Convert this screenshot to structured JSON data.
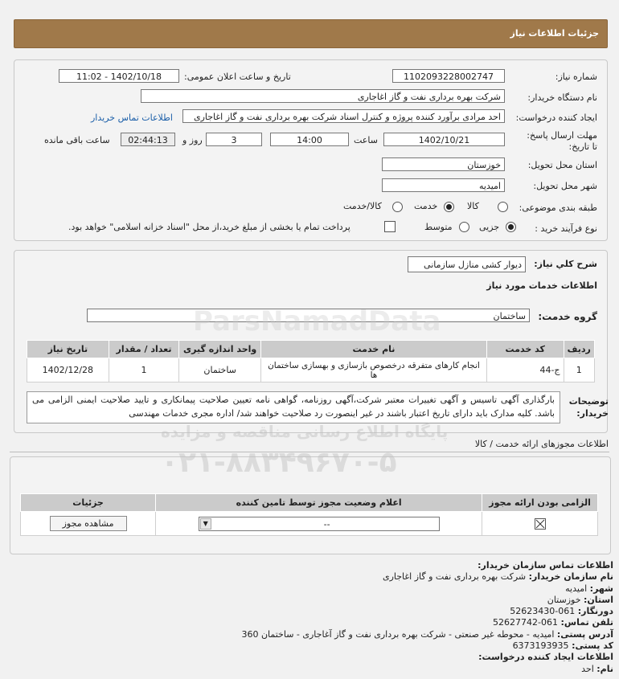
{
  "header": {
    "title": "جزئیات اطلاعات نیاز"
  },
  "need": {
    "number_label": "شماره نیاز:",
    "number": "1102093228002747",
    "announce_label": "تاریخ و ساعت اعلان عمومی:",
    "announce_value": "1402/10/18 - 11:02",
    "buyer_label": "نام دستگاه خریدار:",
    "buyer_value": "شرکت بهره برداری نفت و گاز اغاجاری",
    "creator_label": "ایجاد کننده درخواست:",
    "creator_value": "احد مرادی برآورد کننده پروژه و کنترل اسناد شرکت بهره برداری نفت و گاز اغاجاری",
    "contact_link": "اطلاعات تماس خریدار",
    "deadline_label": "مهلت ارسال پاسخ: تا تاریخ:",
    "deadline_date": "1402/10/21",
    "time_label": "ساعت",
    "deadline_time": "14:00",
    "day_suffix": "روز و",
    "days": "3",
    "remaining": "02:44:13",
    "remaining_label": "ساعت باقی مانده",
    "province_label": "استان محل تحویل:",
    "province": "خوزستان",
    "city_label": "شهر محل تحویل:",
    "city": "امیدیه",
    "category_label": "طبقه بندی موضوعی:",
    "cat_goods": "کالا",
    "cat_service": "خدمت",
    "cat_both": "کالا/خدمت",
    "process_label": "نوع فرآیند خرید :",
    "proc_partial": "جزیی",
    "proc_medium": "متوسط",
    "payment_note": "پرداخت تمام یا بخشی از مبلغ خرید،از محل \"اسناد خزانه اسلامی\" خواهد بود."
  },
  "summary": {
    "label": "شرح کلي نیاز:",
    "value": "دیوار کشی منازل سازمانی",
    "services_title": "اطلاعات خدمات مورد نیاز",
    "group_label": "گروه خدمت:",
    "group_value": "ساختمان"
  },
  "services_table": {
    "headers": [
      "ردیف",
      "کد خدمت",
      "نام خدمت",
      "واحد اندازه گیری",
      "تعداد / مقدار",
      "تاریخ نیاز"
    ],
    "rows": [
      [
        "1",
        "ج-44",
        "انجام کارهای متفرقه درخصوص بازسازی و بهسازی ساختمان ها",
        "ساختمان",
        "1",
        "1402/12/28"
      ]
    ]
  },
  "buyer_notes": {
    "label": "توضیحات خریدار:",
    "text": "بارگذاری آگهی تاسیس و آگهی تغییرات معتبر شرکت،آگهی روزنامه، گواهی نامه تعیین صلاحیت پیمانکاری و تایید صلاحیت ایمنی الزامی می باشد. کلیه مدارک باید دارای تاریخ اعتبار باشند در غیر اینصورت رد صلاحیت خواهند شد/ اداره مجری خدمات مهندسی"
  },
  "permits": {
    "title": "اطلاعات مجوزهای ارائه خدمت / کالا",
    "headers": [
      "الزامی بودن ارائه مجوز",
      "اعلام وضعیت مجوز توسط تامین کننده",
      "جزئیات"
    ],
    "select_value": "--",
    "view_button": "مشاهده مجوز"
  },
  "contact": {
    "title": "اطلاعات تماس سازمان خریدار:",
    "org_label": "نام سازمان خریدار:",
    "org": "شرکت بهره برداری نفت و گاز اغاجاری",
    "city_label": "شهر:",
    "city": "امیدیه",
    "province_label": "استان:",
    "province": "خوزستان",
    "fax_label": "دورنگار:",
    "fax": "061-52623430",
    "phone_label": "تلفن تماس:",
    "phone": "061-52627742",
    "address_label": "آدرس پستی:",
    "address": "امیدیه - محوطه غیر صنعتی - شرکت بهره برداری نفت و گاز آغاجاری - ساختمان 360",
    "postal_label": "کد پستی:",
    "postal": "6373193935",
    "creator_title": "اطلاعات ایجاد کننده درخواست:",
    "name_label": "نام:",
    "name": "احد"
  },
  "watermark": {
    "line1": "پایگاه اطلاع رسانی مناقصه و مزایده",
    "line2": "۰۲۱-۸۸۳۴۹۶۷۰-۵",
    "brand": "ParsNamadData"
  },
  "colors": {
    "header": "#a0794a",
    "link": "#1a5ea8"
  }
}
